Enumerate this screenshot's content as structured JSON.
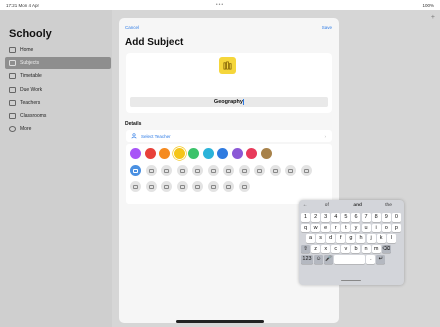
{
  "status_bar": {
    "time": "17:21",
    "date": "Mon 4 Apr",
    "battery": "100%"
  },
  "app": {
    "title": "Schooly"
  },
  "sidebar": {
    "items": [
      {
        "label": "Home",
        "icon": "home-icon"
      },
      {
        "label": "Subjects",
        "icon": "subjects-icon",
        "active": true
      },
      {
        "label": "Timetable",
        "icon": "timetable-icon"
      },
      {
        "label": "Due Work",
        "icon": "due-work-icon"
      },
      {
        "label": "Teachers",
        "icon": "teachers-icon"
      },
      {
        "label": "Classrooms",
        "icon": "classrooms-icon"
      },
      {
        "label": "More",
        "icon": "more-icon"
      }
    ]
  },
  "sheet": {
    "cancel_label": "Cancel",
    "save_label": "Save",
    "title": "Add Subject",
    "subject_name": "Geography",
    "details_label": "Details",
    "select_teacher_label": "Select Teacher"
  },
  "colors": [
    "#a855f7",
    "#e8413a",
    "#f58a1f",
    "#f5c518",
    "#3cc36b",
    "#2bb3d9",
    "#2f7be0",
    "#8b58d6",
    "#e83a5a",
    "#a8824a"
  ],
  "selected_color_index": 3,
  "glyphs": [
    "plus-icon",
    "atom-icon",
    "globe-icon",
    "clock-icon",
    "calculator-icon",
    "book-icon",
    "music-icon",
    "flask-icon",
    "palette-icon",
    "language-icon",
    "laptop-icon",
    "monitor-icon",
    "camera-icon",
    "pencil-icon",
    "books-icon",
    "dna-icon",
    "brain-icon",
    "theater-icon",
    "heart-icon",
    "map-icon"
  ],
  "keyboard": {
    "suggestions": [
      "of",
      "and",
      "the"
    ],
    "row1": [
      "1",
      "2",
      "3",
      "4",
      "5",
      "6",
      "7",
      "8",
      "9",
      "0"
    ],
    "row2": [
      "q",
      "w",
      "e",
      "r",
      "t",
      "y",
      "u",
      "i",
      "o",
      "p"
    ],
    "row3": [
      "a",
      "s",
      "d",
      "f",
      "g",
      "h",
      "j",
      "k",
      "l"
    ],
    "row4": [
      "⇧",
      "z",
      "x",
      "c",
      "v",
      "b",
      "n",
      "m",
      "⌫"
    ],
    "row5": [
      "123",
      "☺",
      "🎤",
      "",
      ".",
      "↵"
    ]
  }
}
